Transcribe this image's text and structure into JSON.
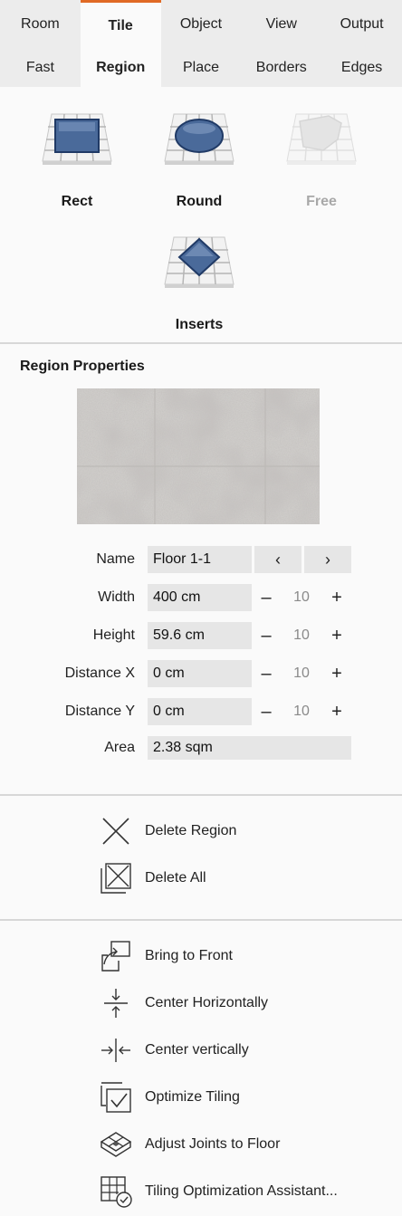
{
  "tabs": [
    "Room",
    "Tile",
    "Object",
    "View",
    "Output"
  ],
  "subtabs": [
    "Fast",
    "Region",
    "Place",
    "Borders",
    "Edges"
  ],
  "shapes": {
    "rect": "Rect",
    "round": "Round",
    "free": "Free",
    "inserts": "Inserts"
  },
  "region": {
    "title": "Region Properties",
    "name_label": "Name",
    "name_value": "Floor 1-1",
    "prev": "‹",
    "next": "›",
    "width_label": "Width",
    "width_value": "400 cm",
    "height_label": "Height",
    "height_value": "59.6 cm",
    "dx_label": "Distance X",
    "dx_value": "0 cm",
    "dy_label": "Distance Y",
    "dy_value": "0 cm",
    "area_label": "Area",
    "area_value": "2.38 sqm",
    "step": "10",
    "minus": "–",
    "plus": "+"
  },
  "actions": {
    "delete_region": "Delete Region",
    "delete_all": "Delete All",
    "bring_front": "Bring to Front",
    "center_h": "Center Horizontally",
    "center_v": "Center vertically",
    "optimize": "Optimize Tiling",
    "adjust_joints": "Adjust Joints to Floor",
    "assistant": "Tiling Optimization Assistant..."
  },
  "colors": {
    "accent": "#e06a25",
    "tile_blue": "#4a6a9a"
  }
}
